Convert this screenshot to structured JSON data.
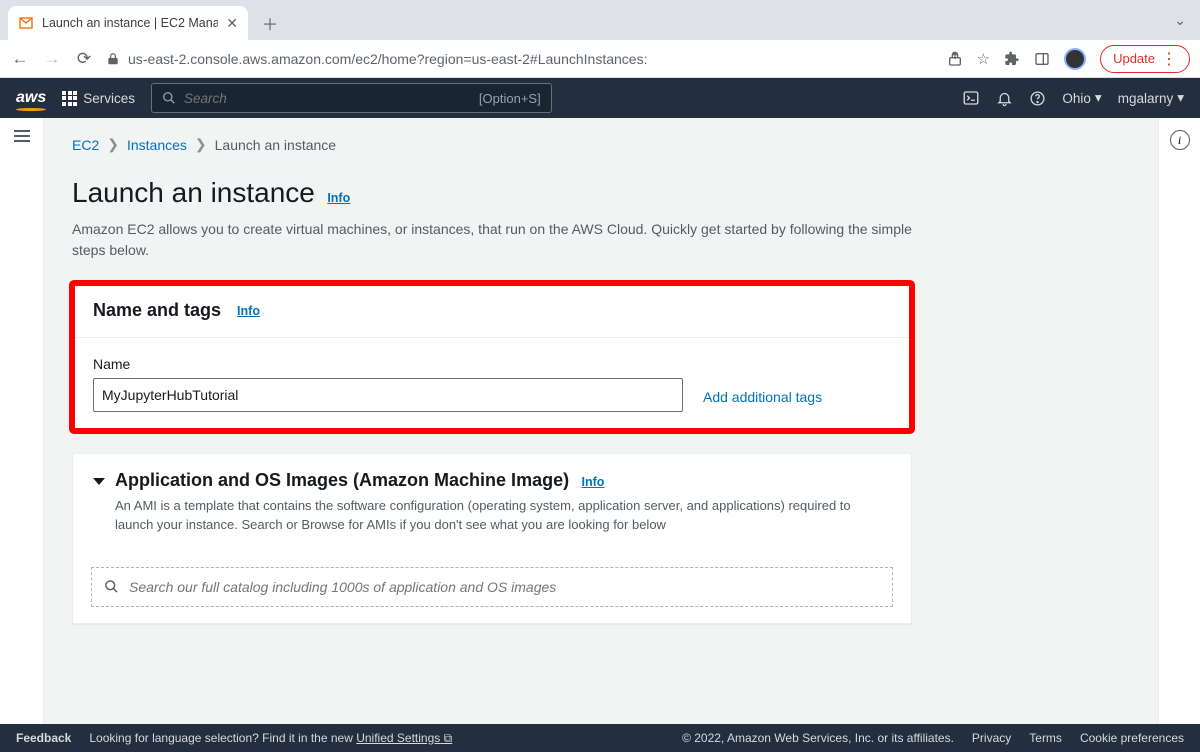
{
  "browser": {
    "tab_title": "Launch an instance | EC2 Mana",
    "url": "us-east-2.console.aws.amazon.com/ec2/home?region=us-east-2#LaunchInstances:",
    "update_label": "Update"
  },
  "aws_nav": {
    "services": "Services",
    "search_placeholder": "Search",
    "search_hint": "[Option+S]",
    "region": "Ohio",
    "user": "mgalarny"
  },
  "breadcrumb": {
    "root": "EC2",
    "mid": "Instances",
    "current": "Launch an instance"
  },
  "page": {
    "title": "Launch an instance",
    "info": "Info",
    "description": "Amazon EC2 allows you to create virtual machines, or instances, that run on the AWS Cloud. Quickly get started by following the simple steps below."
  },
  "name_panel": {
    "title": "Name and tags",
    "info": "Info",
    "field_label": "Name",
    "value": "MyJupyterHubTutorial",
    "add_tags": "Add additional tags"
  },
  "ami_panel": {
    "title": "Application and OS Images (Amazon Machine Image)",
    "info": "Info",
    "description": "An AMI is a template that contains the software configuration (operating system, application server, and applications) required to launch your instance. Search or Browse for AMIs if you don't see what you are looking for below",
    "search_placeholder": "Search our full catalog including 1000s of application and OS images"
  },
  "footer": {
    "feedback": "Feedback",
    "lang_prompt": "Looking for language selection? Find it in the new",
    "unified": "Unified Settings",
    "copyright": "© 2022, Amazon Web Services, Inc. or its affiliates.",
    "privacy": "Privacy",
    "terms": "Terms",
    "cookies": "Cookie preferences"
  }
}
